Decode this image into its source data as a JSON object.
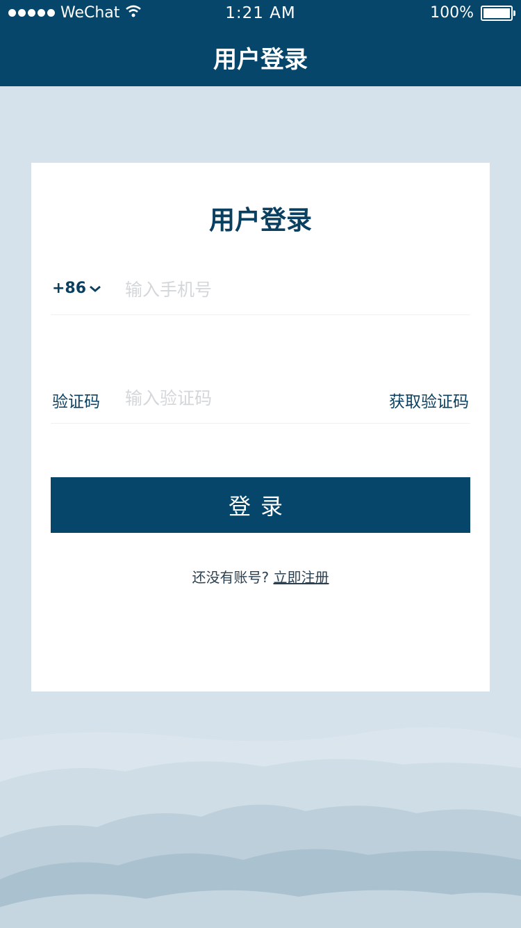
{
  "status_bar": {
    "carrier": "WeChat",
    "time": "1:21 AM",
    "battery_percent": "100%"
  },
  "nav": {
    "title": "用户登录"
  },
  "card": {
    "title": "用户登录",
    "phone_prefix": "+86",
    "phone_placeholder": "输入手机号",
    "code_label": "验证码",
    "code_placeholder": "输入验证码",
    "get_code_label": "获取验证码",
    "login_label": "登录",
    "no_account_text": "还没有账号?",
    "register_link": "立即注册"
  },
  "colors": {
    "primary": "#05466a",
    "background": "#d6e2eb",
    "card": "#ffffff",
    "title_text": "#0a3f5f"
  },
  "icons": [
    "wifi-icon",
    "battery-icon",
    "chevron-down-icon"
  ]
}
